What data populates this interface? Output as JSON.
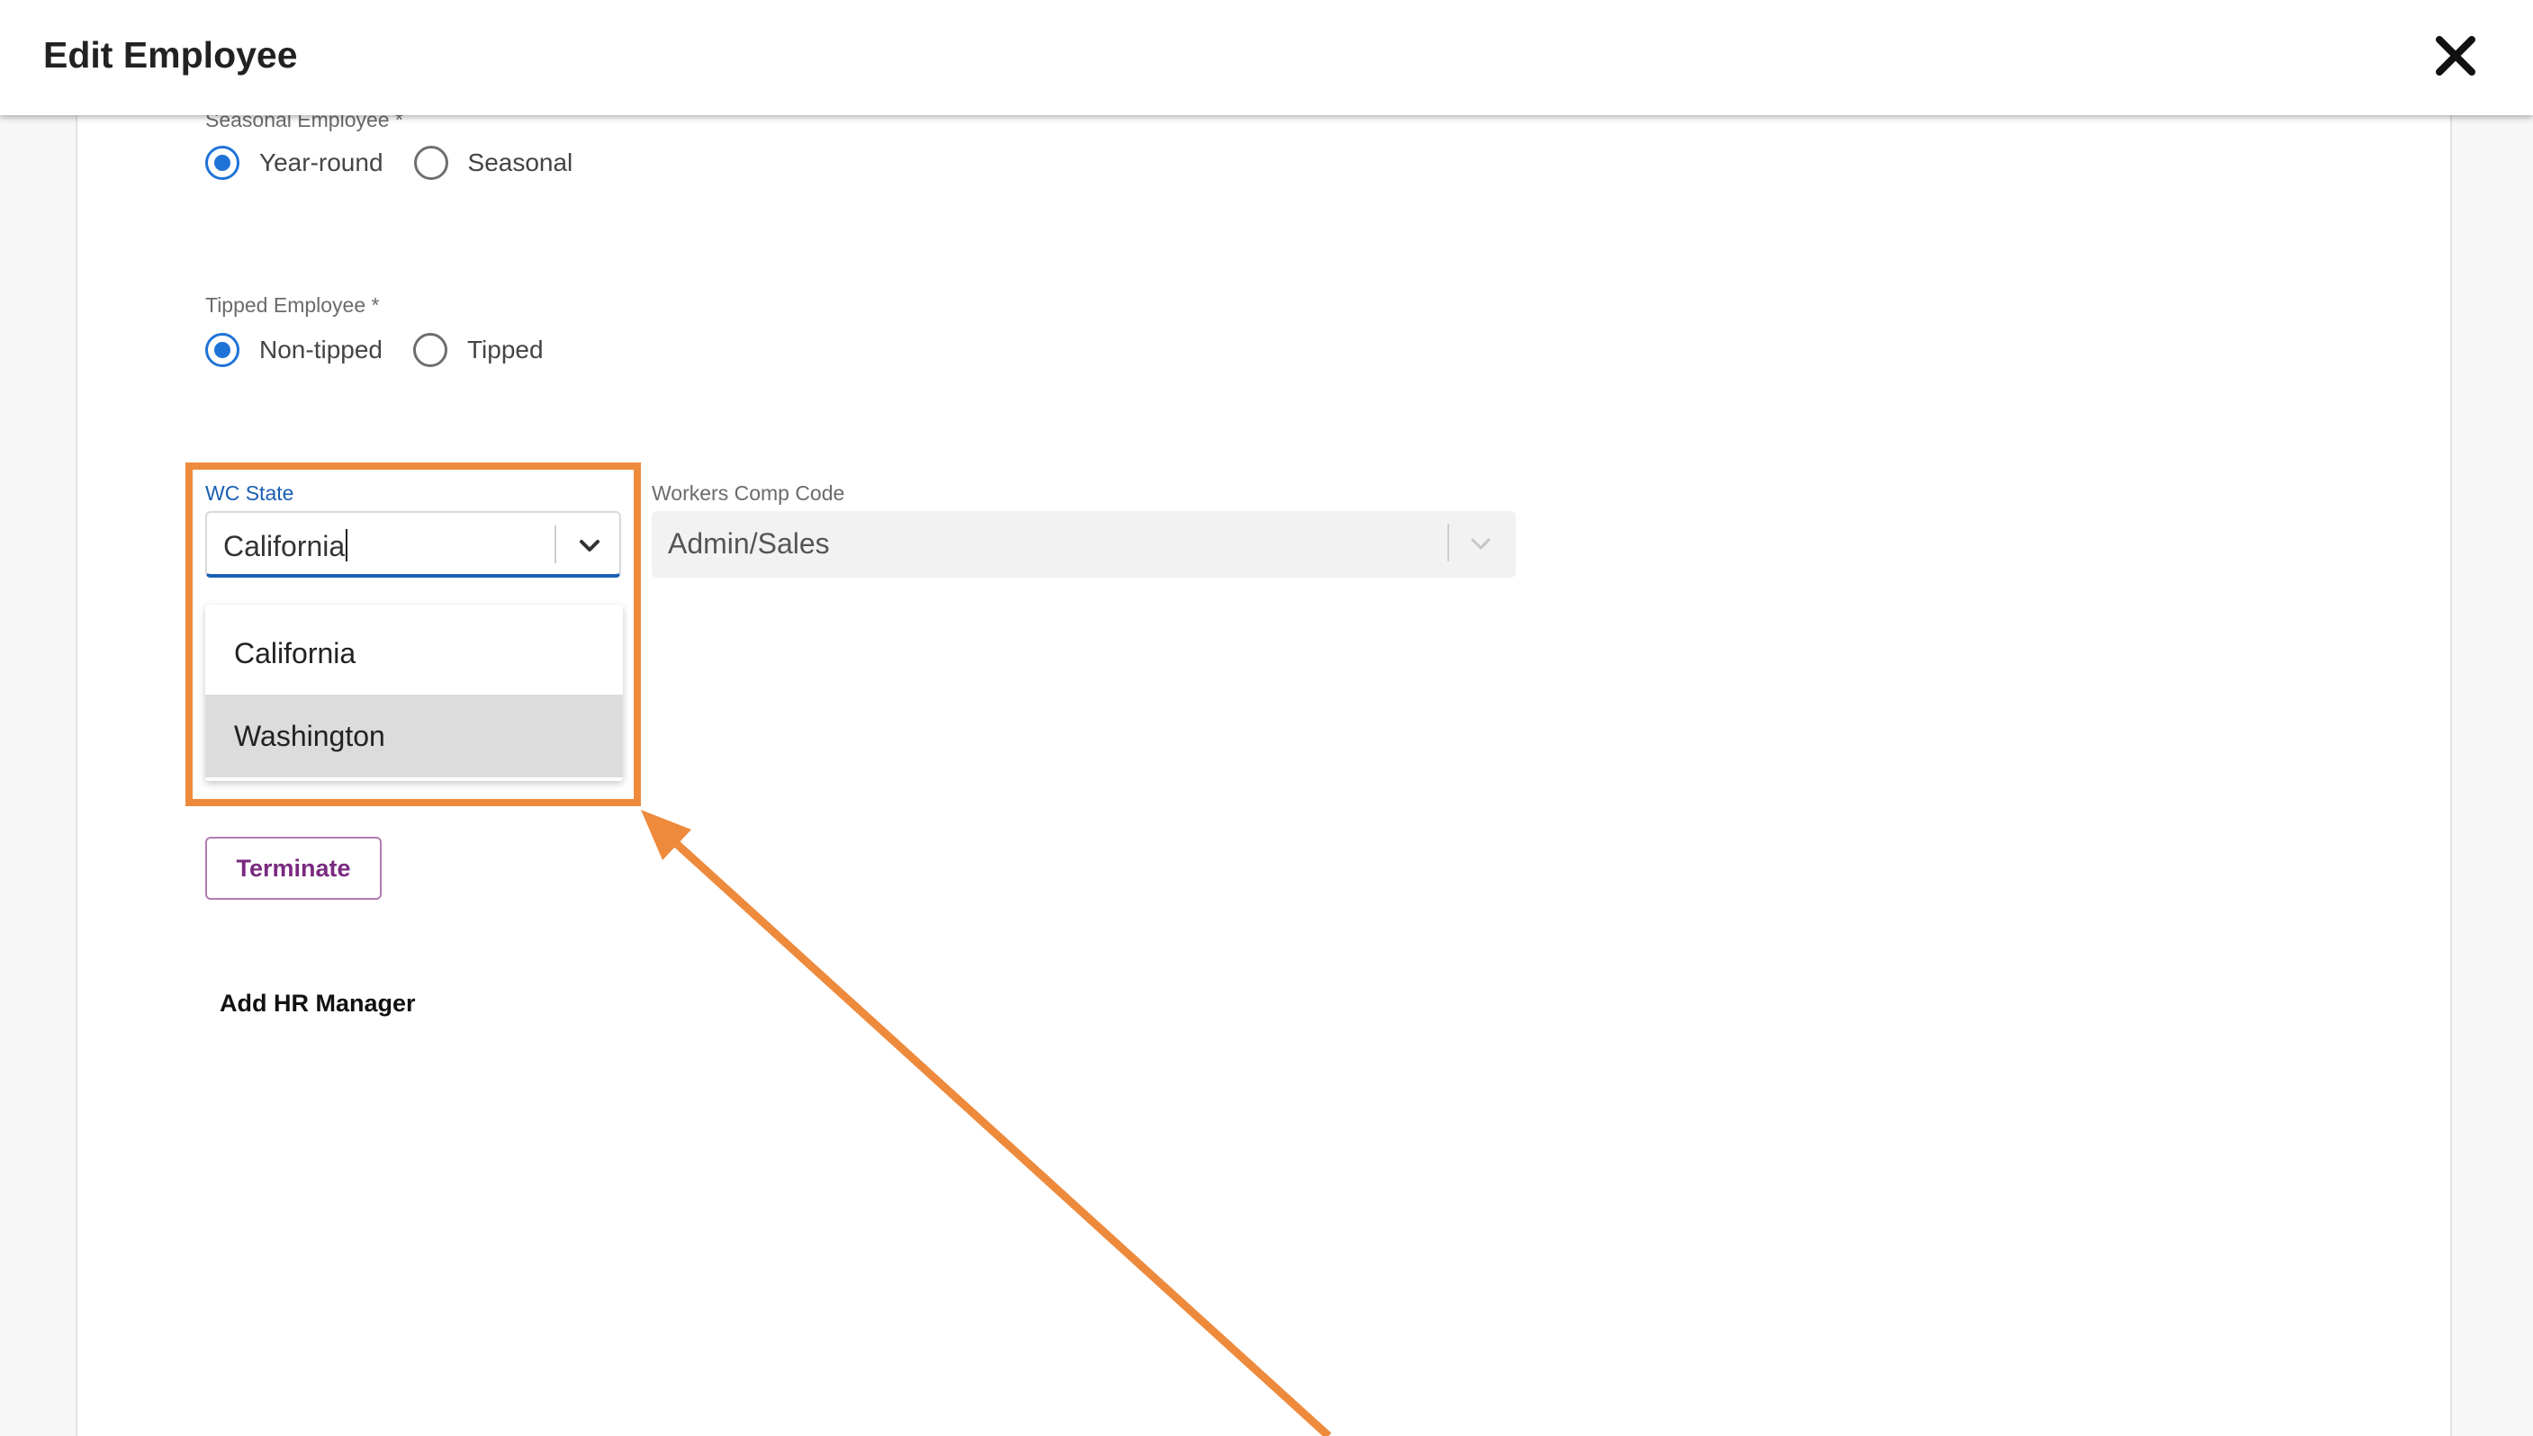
{
  "dialog": {
    "title": "Edit Employee",
    "close_icon": "close-icon"
  },
  "seasonal": {
    "label": "Seasonal Employee *",
    "options": [
      {
        "label": "Year-round",
        "selected": true
      },
      {
        "label": "Seasonal",
        "selected": false
      }
    ]
  },
  "tipped": {
    "label": "Tipped Employee *",
    "options": [
      {
        "label": "Non-tipped",
        "selected": true
      },
      {
        "label": "Tipped",
        "selected": false
      }
    ]
  },
  "wc_state": {
    "label": "WC State",
    "value": "California",
    "dropdown_options": [
      "California",
      "Washington"
    ],
    "highlighted_option": "Washington"
  },
  "workers_comp": {
    "label": "Workers Comp Code",
    "value": "Admin/Sales",
    "disabled": true
  },
  "actions": {
    "terminate_label": "Terminate",
    "add_hr_label": "Add HR Manager"
  },
  "colors": {
    "annotation": "#ee8a3c",
    "accent": "#1a5fb4",
    "radio_selected": "#1f73d6",
    "terminate_text": "#7a2a80"
  }
}
